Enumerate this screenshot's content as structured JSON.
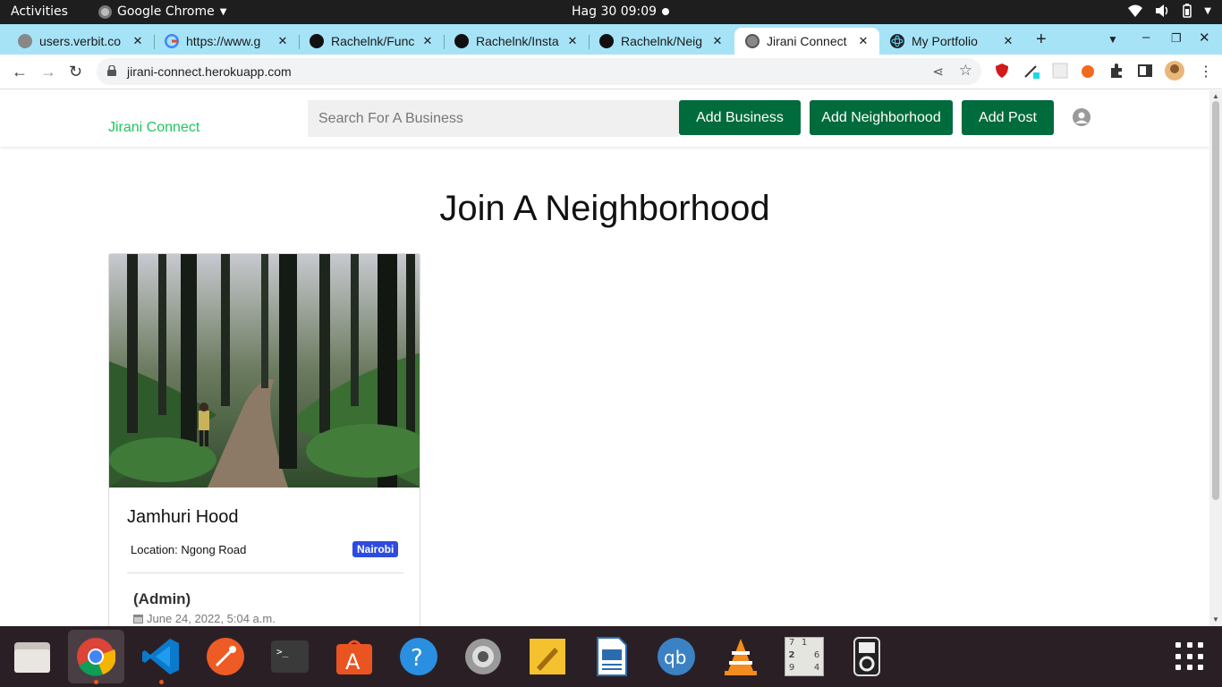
{
  "system_bar": {
    "activities": "Activities",
    "app_name": "Google Chrome",
    "clock": "Hag 30  09:09"
  },
  "tabs": [
    {
      "title": "users.verbit.co",
      "icon": "generic-globe-icon",
      "active": false
    },
    {
      "title": "https://www.g",
      "icon": "google-icon",
      "active": false
    },
    {
      "title": "Rachelnk/Func",
      "icon": "github-icon",
      "active": false
    },
    {
      "title": "Rachelnk/Insta",
      "icon": "github-icon",
      "active": false
    },
    {
      "title": "Rachelnk/Neig",
      "icon": "github-icon",
      "active": false
    },
    {
      "title": "Jirani Connect",
      "icon": "generic-globe-icon",
      "active": true
    },
    {
      "title": "My Portfolio",
      "icon": "react-icon",
      "active": false
    }
  ],
  "address_bar": {
    "url": "jirani-connect.herokuapp.com"
  },
  "site": {
    "brand": "Jirani Connect",
    "search_placeholder": "Search For A Business",
    "buttons": {
      "add_business": "Add Business",
      "add_neighborhood": "Add Neighborhood",
      "add_post": "Add Post"
    },
    "accent_color": "#006b3c",
    "brand_color": "#22c55e"
  },
  "main": {
    "heading": "Join A Neighborhood",
    "cards": [
      {
        "name": "Jamhuri Hood",
        "location": "Location: Ngong Road",
        "badge": "Nairobi",
        "admin": "(Admin)",
        "date": "June 24, 2022, 5:04 a.m."
      }
    ]
  },
  "dock": {
    "apps": [
      "files-icon",
      "chrome-icon",
      "vscode-icon",
      "postman-icon",
      "terminal-icon",
      "software-center-icon",
      "help-icon",
      "settings-icon",
      "notes-icon",
      "writer-icon",
      "qbittorrent-icon",
      "vlc-icon",
      "sudoku-icon",
      "ipod-icon",
      "show-apps-icon"
    ],
    "sudoku_digits": [
      "7",
      "1",
      "2",
      "6",
      "9",
      "4"
    ]
  }
}
